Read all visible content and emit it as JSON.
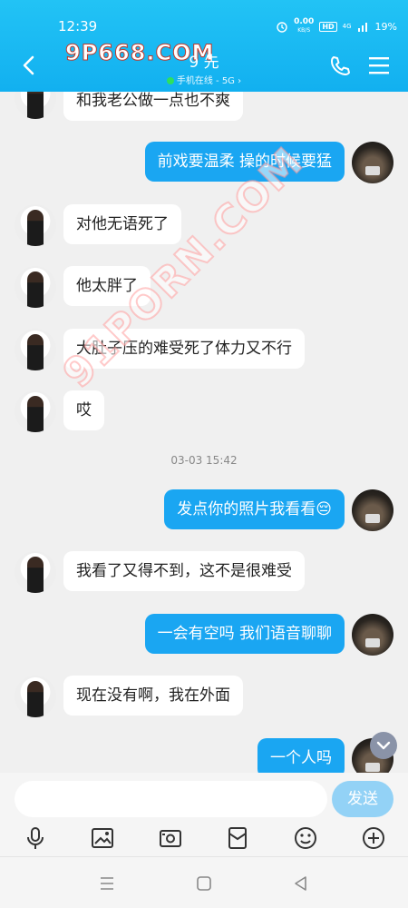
{
  "status": {
    "time": "12:39",
    "netspeed": "0.00",
    "netunit": "KB/S",
    "hd": "HD",
    "signal": "4G",
    "battery": "19%"
  },
  "header": {
    "title": "9 先",
    "online_status": "手机在线 - 5G",
    "watermark": "9P668.COM"
  },
  "chat_watermark": "91PORN.COM",
  "messages": [
    {
      "side": "in",
      "text": "和我老公做一点也不爽"
    },
    {
      "side": "out",
      "text": "前戏要温柔 操的时候要猛"
    },
    {
      "side": "in",
      "text": "对他无语死了"
    },
    {
      "side": "in",
      "text": "他太胖了"
    },
    {
      "side": "in",
      "text": "大肚子压的难受死了体力又不行"
    },
    {
      "side": "in",
      "text": "哎"
    },
    {
      "timestamp": "03-03 15:42"
    },
    {
      "side": "out",
      "text": "发点你的照片我看看😔"
    },
    {
      "side": "in",
      "text": "我看了又得不到，这不是很难受"
    },
    {
      "side": "out",
      "text": "一会有空吗 我们语音聊聊"
    },
    {
      "side": "in",
      "text": "现在没有啊，我在外面"
    },
    {
      "side": "out",
      "text": "一个人吗"
    }
  ],
  "input": {
    "placeholder": "",
    "send_label": "发送"
  },
  "toolbar": [
    "mic-icon",
    "image-icon",
    "camera-icon",
    "red-packet-icon",
    "emoji-icon",
    "plus-icon"
  ],
  "colors": {
    "header": "#12b0f0",
    "outgoing_bubble": "#1aa6f2",
    "incoming_bubble": "#ffffff",
    "send_button": "#93d2f6"
  }
}
